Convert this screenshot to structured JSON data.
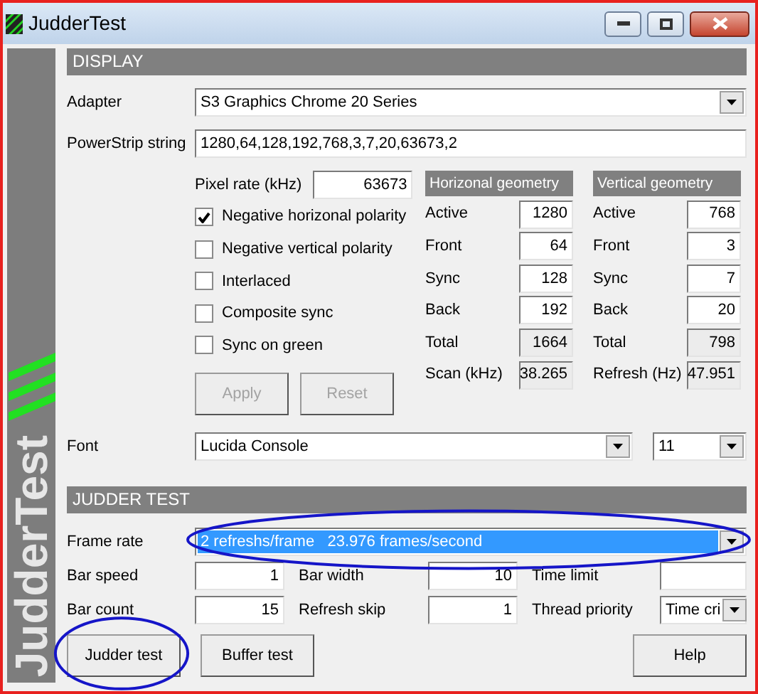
{
  "window": {
    "title": "JudderTest"
  },
  "side_banner": {
    "text": "JudderTest"
  },
  "display": {
    "header": "DISPLAY",
    "adapter": {
      "label": "Adapter",
      "value": "S3 Graphics Chrome 20 Series"
    },
    "powerstrip": {
      "label": "PowerStrip string",
      "value": "1280,64,128,192,768,3,7,20,63673,2"
    },
    "pixel_rate": {
      "label": "Pixel rate (kHz)",
      "value": "63673"
    },
    "options": [
      {
        "label": "Negative horizonal polarity",
        "checked": true
      },
      {
        "label": "Negative vertical polarity",
        "checked": false
      },
      {
        "label": "Interlaced",
        "checked": false
      },
      {
        "label": "Composite sync",
        "checked": false
      },
      {
        "label": "Sync on green",
        "checked": false
      }
    ],
    "buttons": [
      {
        "label": "Apply",
        "disabled": true
      },
      {
        "label": "Reset",
        "disabled": true
      }
    ],
    "geometry": [
      {
        "header": "Horizonal geometry",
        "rows": [
          {
            "label": "Active",
            "value": "1280",
            "readonly": false
          },
          {
            "label": "Front",
            "value": "64",
            "readonly": false
          },
          {
            "label": "Sync",
            "value": "128",
            "readonly": false
          },
          {
            "label": "Back",
            "value": "192",
            "readonly": false
          },
          {
            "label": "Total",
            "value": "1664",
            "readonly": true
          },
          {
            "label": "Scan (kHz)",
            "value": "38.265",
            "readonly": true
          }
        ]
      },
      {
        "header": "Vertical geometry",
        "rows": [
          {
            "label": "Active",
            "value": "768",
            "readonly": false
          },
          {
            "label": "Front",
            "value": "3",
            "readonly": false
          },
          {
            "label": "Sync",
            "value": "7",
            "readonly": false
          },
          {
            "label": "Back",
            "value": "20",
            "readonly": false
          },
          {
            "label": "Total",
            "value": "798",
            "readonly": true
          },
          {
            "label": "Refresh (Hz)",
            "value": "47.951",
            "readonly": true
          }
        ]
      }
    ],
    "font": {
      "label": "Font",
      "value": "Lucida Console",
      "size": "11"
    }
  },
  "judder_test": {
    "header": "JUDDER TEST",
    "frame_rate": {
      "label": "Frame rate",
      "value": "2 refreshs/frame   23.976 frames/second",
      "circled": true
    },
    "rows": [
      [
        {
          "label": "Bar speed",
          "value": "1",
          "kind": "number"
        },
        {
          "label": "Bar width",
          "value": "10",
          "kind": "number"
        },
        {
          "label": "Time limit",
          "kind": "number"
        }
      ],
      [
        {
          "label": "Bar count",
          "value": "15",
          "kind": "number"
        },
        {
          "label": "Refresh skip",
          "value": "1",
          "kind": "number"
        },
        {
          "label": "Thread priority",
          "value": "Time cri",
          "kind": "dropdown"
        }
      ]
    ],
    "buttons": [
      {
        "label": "Judder test",
        "circled": true
      },
      {
        "label": "Buffer test",
        "circled": false
      },
      {
        "label": "Help",
        "circled": false
      }
    ]
  }
}
